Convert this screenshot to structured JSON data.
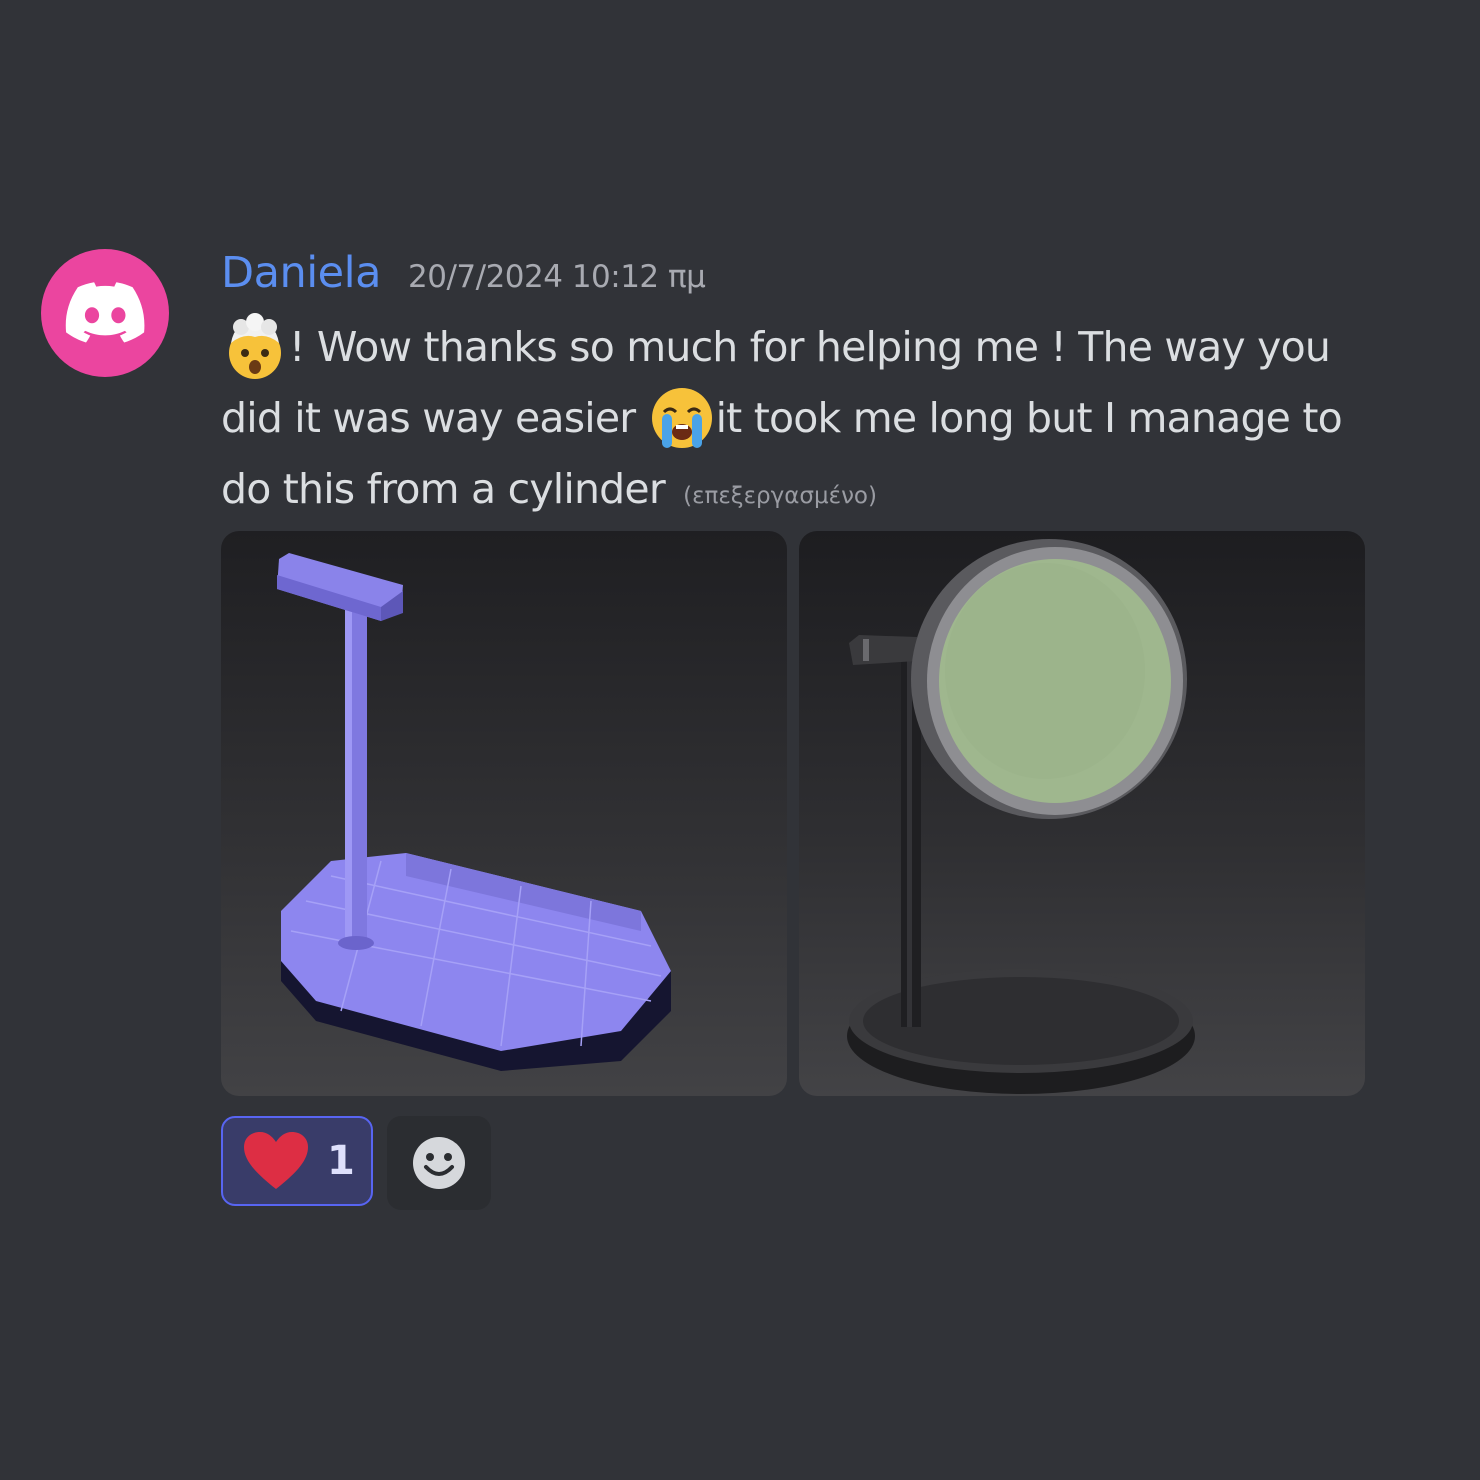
{
  "message": {
    "author": "Daniela",
    "timestamp": "20/7/2024 10:12 πμ",
    "text_part_1": "!  Wow thanks so much for helping me ! The  way you did it was way  easier ",
    "text_part_2": "it took me long but I manage to do this from a cylinder",
    "edited_label": "(επεξεργασμένο)",
    "emojis": [
      "exploding-head-emoji",
      "loudly-crying-face-emoji"
    ]
  },
  "attachments": [
    {
      "name": "headphone-stand-wireframe-image",
      "description_icon": "3d-model-image"
    },
    {
      "name": "mirror-stand-render-image",
      "description_icon": "3d-model-image"
    }
  ],
  "reactions": [
    {
      "emoji": "red-heart-emoji",
      "count": "1",
      "selected": true
    }
  ],
  "colors": {
    "background": "#313338",
    "username": "#5b8ef0",
    "avatar": "#eb459f",
    "reaction_border": "#5865f2"
  }
}
